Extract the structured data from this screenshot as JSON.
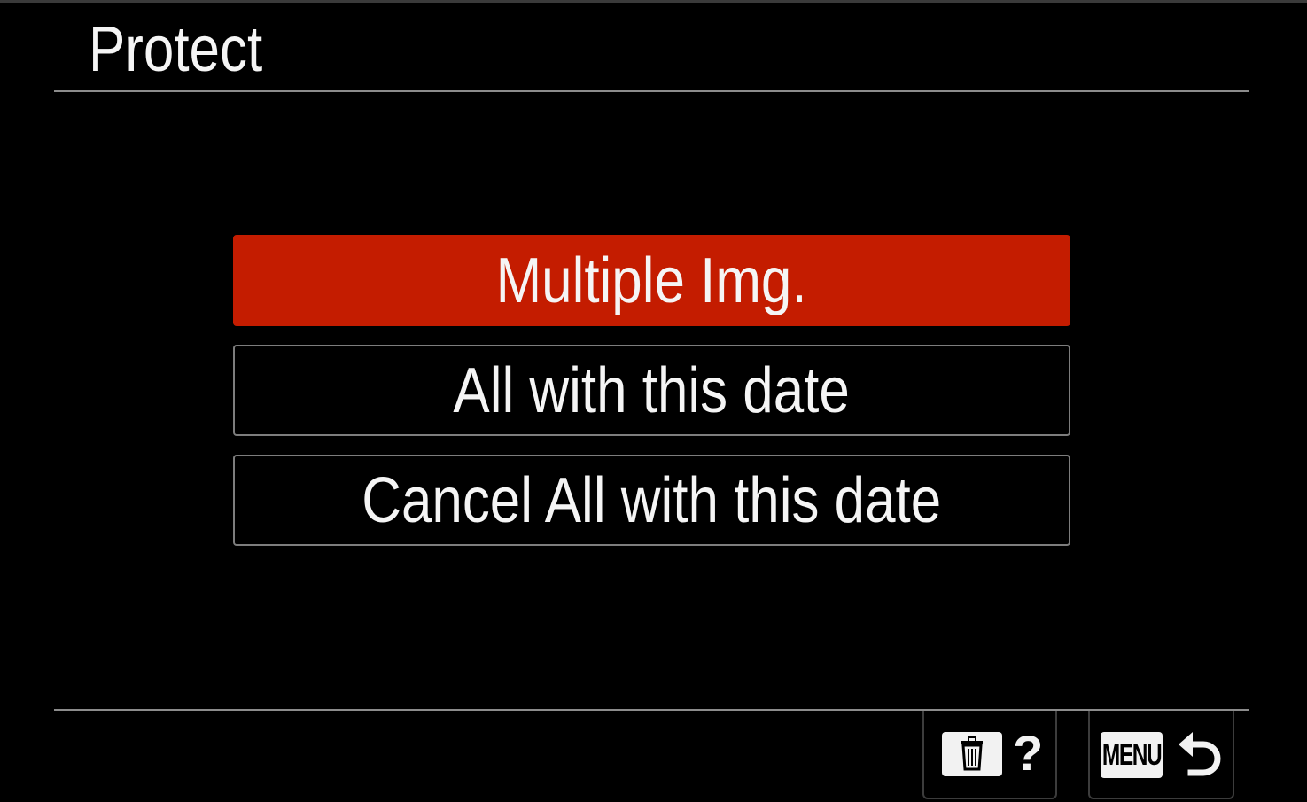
{
  "screen": {
    "title": "Protect"
  },
  "menu": {
    "items": [
      {
        "label": "Multiple Img.",
        "selected": true
      },
      {
        "label": "All with this date",
        "selected": false
      },
      {
        "label": "Cancel All with this date",
        "selected": false
      }
    ]
  },
  "softkeys": {
    "delete_help": {
      "icon": "trash-icon",
      "glyph": "?"
    },
    "menu_back": {
      "badge": "MENU",
      "icon": "return-arrow-icon"
    }
  },
  "colors": {
    "background": "#000000",
    "selected": "#c41c00",
    "text": "#f5f5f5",
    "outline": "#7d7d7d"
  }
}
